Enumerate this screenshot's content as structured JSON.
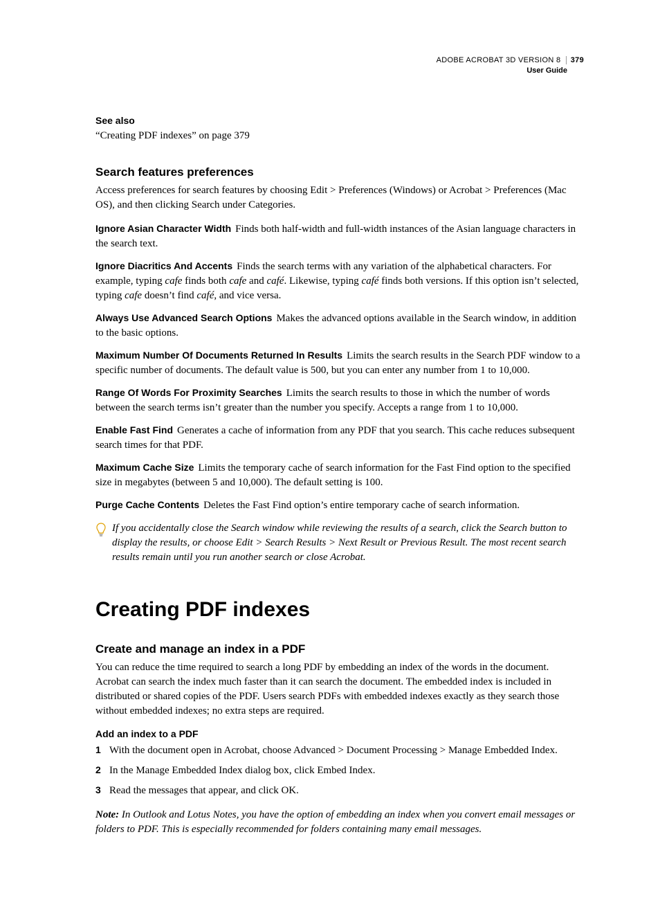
{
  "header": {
    "product": "ADOBE ACROBAT 3D VERSION 8",
    "page_number": "379",
    "guide": "User Guide"
  },
  "see_also": {
    "title": "See also",
    "link_text": "“Creating PDF indexes” on page 379"
  },
  "prefs": {
    "heading": "Search features preferences",
    "intro": "Access preferences for search features by choosing Edit > Preferences (Windows) or Acrobat  > Preferences (Mac OS), and then clicking Search under Categories.",
    "items": [
      {
        "term": "Ignore Asian Character Width",
        "desc": "Finds both half-width and full-width instances of the Asian language characters in the search text."
      },
      {
        "term": "Ignore Diacritics And Accents",
        "desc_parts": [
          "Finds the search terms with any variation of the alphabetical characters. For example, typing ",
          "cafe",
          " finds both ",
          "cafe",
          " and ",
          "café",
          ". Likewise, typing ",
          "café",
          " finds both versions. If this option isn’t selected, typing ",
          "cafe",
          " doesn’t find ",
          "café",
          ", and vice versa."
        ]
      },
      {
        "term": "Always Use Advanced Search Options",
        "desc": "Makes the advanced options available in the Search window, in addition to the basic options."
      },
      {
        "term": "Maximum Number Of Documents Returned In Results",
        "desc": "Limits the search results in the Search PDF window to a specific number of documents. The default value is 500, but you can enter any number from 1 to 10,000."
      },
      {
        "term": "Range Of Words For Proximity Searches",
        "desc": "Limits the search results to those in which the number of words between the search terms isn’t greater than the number you specify. Accepts a range from 1 to 10,000."
      },
      {
        "term": "Enable Fast Find",
        "desc": "Generates a cache of information from any PDF that you search. This cache reduces subsequent search times for that PDF."
      },
      {
        "term": "Maximum Cache Size",
        "desc": "Limits the temporary cache of search information for the Fast Find option to the specified size in megabytes (between 5 and 10,000). The default setting is 100."
      },
      {
        "term": "Purge Cache Contents",
        "desc": "Deletes the Fast Find option’s entire temporary cache of search information."
      }
    ],
    "tip": "If you accidentally close the Search window while reviewing the results of a search, click the Search button to display the results, or choose Edit > Search Results > Next Result or Previous Result. The most recent search results remain until you run another search or close Acrobat."
  },
  "chapter": {
    "title": "Creating PDF indexes",
    "section": {
      "heading": "Create and manage an index in a PDF",
      "body": "You can reduce the time required to search a long PDF by embedding an index of the words in the document. Acrobat can search the index much faster than it can search the document. The embedded index is included in distributed or shared copies of the PDF. Users search PDFs with embedded indexes exactly as they search those without embedded indexes; no extra steps are required.",
      "task_heading": "Add an index to a PDF",
      "steps": [
        "With the document open in Acrobat, choose Advanced > Document Processing > Manage Embedded Index.",
        "In the Manage Embedded Index dialog box, click Embed Index.",
        "Read the messages that appear, and click OK."
      ],
      "note_label": "Note:",
      "note": "In Outlook and Lotus Notes, you have the option of embedding an index when you convert email messages or folders to PDF. This is especially recommended for folders containing many email messages."
    }
  }
}
